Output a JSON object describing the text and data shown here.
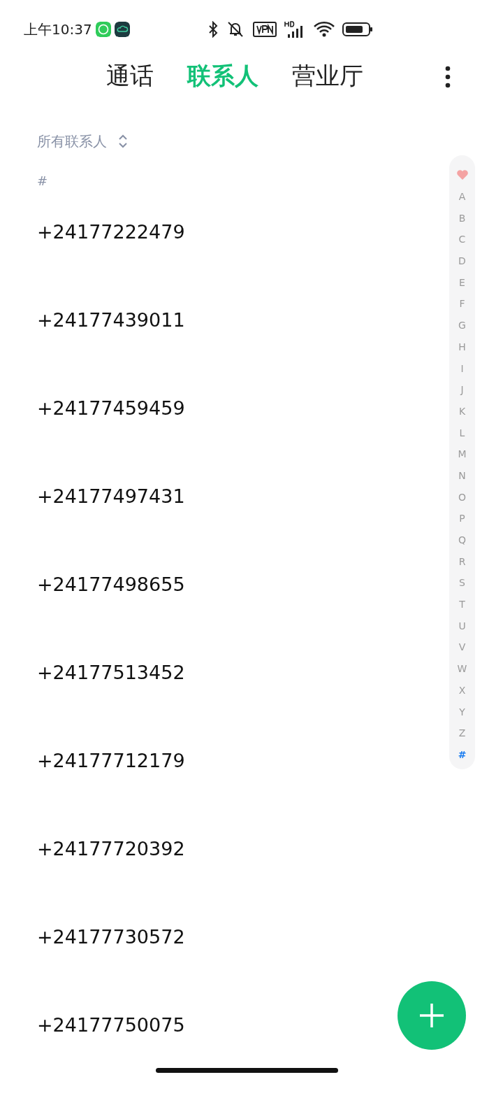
{
  "status_bar": {
    "time": "上午10:37"
  },
  "tabs": [
    {
      "label": "通话",
      "selected": false
    },
    {
      "label": "联系人",
      "selected": true
    },
    {
      "label": "营业厅",
      "selected": false
    }
  ],
  "filter": {
    "label": "所有联系人"
  },
  "section": {
    "label": "#"
  },
  "contacts": [
    {
      "name": "+24177222479"
    },
    {
      "name": "+24177439011"
    },
    {
      "name": "+24177459459"
    },
    {
      "name": "+24177497431"
    },
    {
      "name": "+24177498655"
    },
    {
      "name": "+24177513452"
    },
    {
      "name": "+24177712179"
    },
    {
      "name": "+24177720392"
    },
    {
      "name": "+24177730572"
    },
    {
      "name": "+24177750075"
    }
  ],
  "index": [
    {
      "label": "A",
      "selected": false
    },
    {
      "label": "B",
      "selected": false
    },
    {
      "label": "C",
      "selected": false
    },
    {
      "label": "D",
      "selected": false
    },
    {
      "label": "E",
      "selected": false
    },
    {
      "label": "F",
      "selected": false
    },
    {
      "label": "G",
      "selected": false
    },
    {
      "label": "H",
      "selected": false
    },
    {
      "label": "I",
      "selected": false
    },
    {
      "label": "J",
      "selected": false
    },
    {
      "label": "K",
      "selected": false
    },
    {
      "label": "L",
      "selected": false
    },
    {
      "label": "M",
      "selected": false
    },
    {
      "label": "N",
      "selected": false
    },
    {
      "label": "O",
      "selected": false
    },
    {
      "label": "P",
      "selected": false
    },
    {
      "label": "Q",
      "selected": false
    },
    {
      "label": "R",
      "selected": false
    },
    {
      "label": "S",
      "selected": false
    },
    {
      "label": "T",
      "selected": false
    },
    {
      "label": "U",
      "selected": false
    },
    {
      "label": "V",
      "selected": false
    },
    {
      "label": "W",
      "selected": false
    },
    {
      "label": "X",
      "selected": false
    },
    {
      "label": "Y",
      "selected": false
    },
    {
      "label": "Z",
      "selected": false
    },
    {
      "label": "#",
      "selected": true
    }
  ]
}
